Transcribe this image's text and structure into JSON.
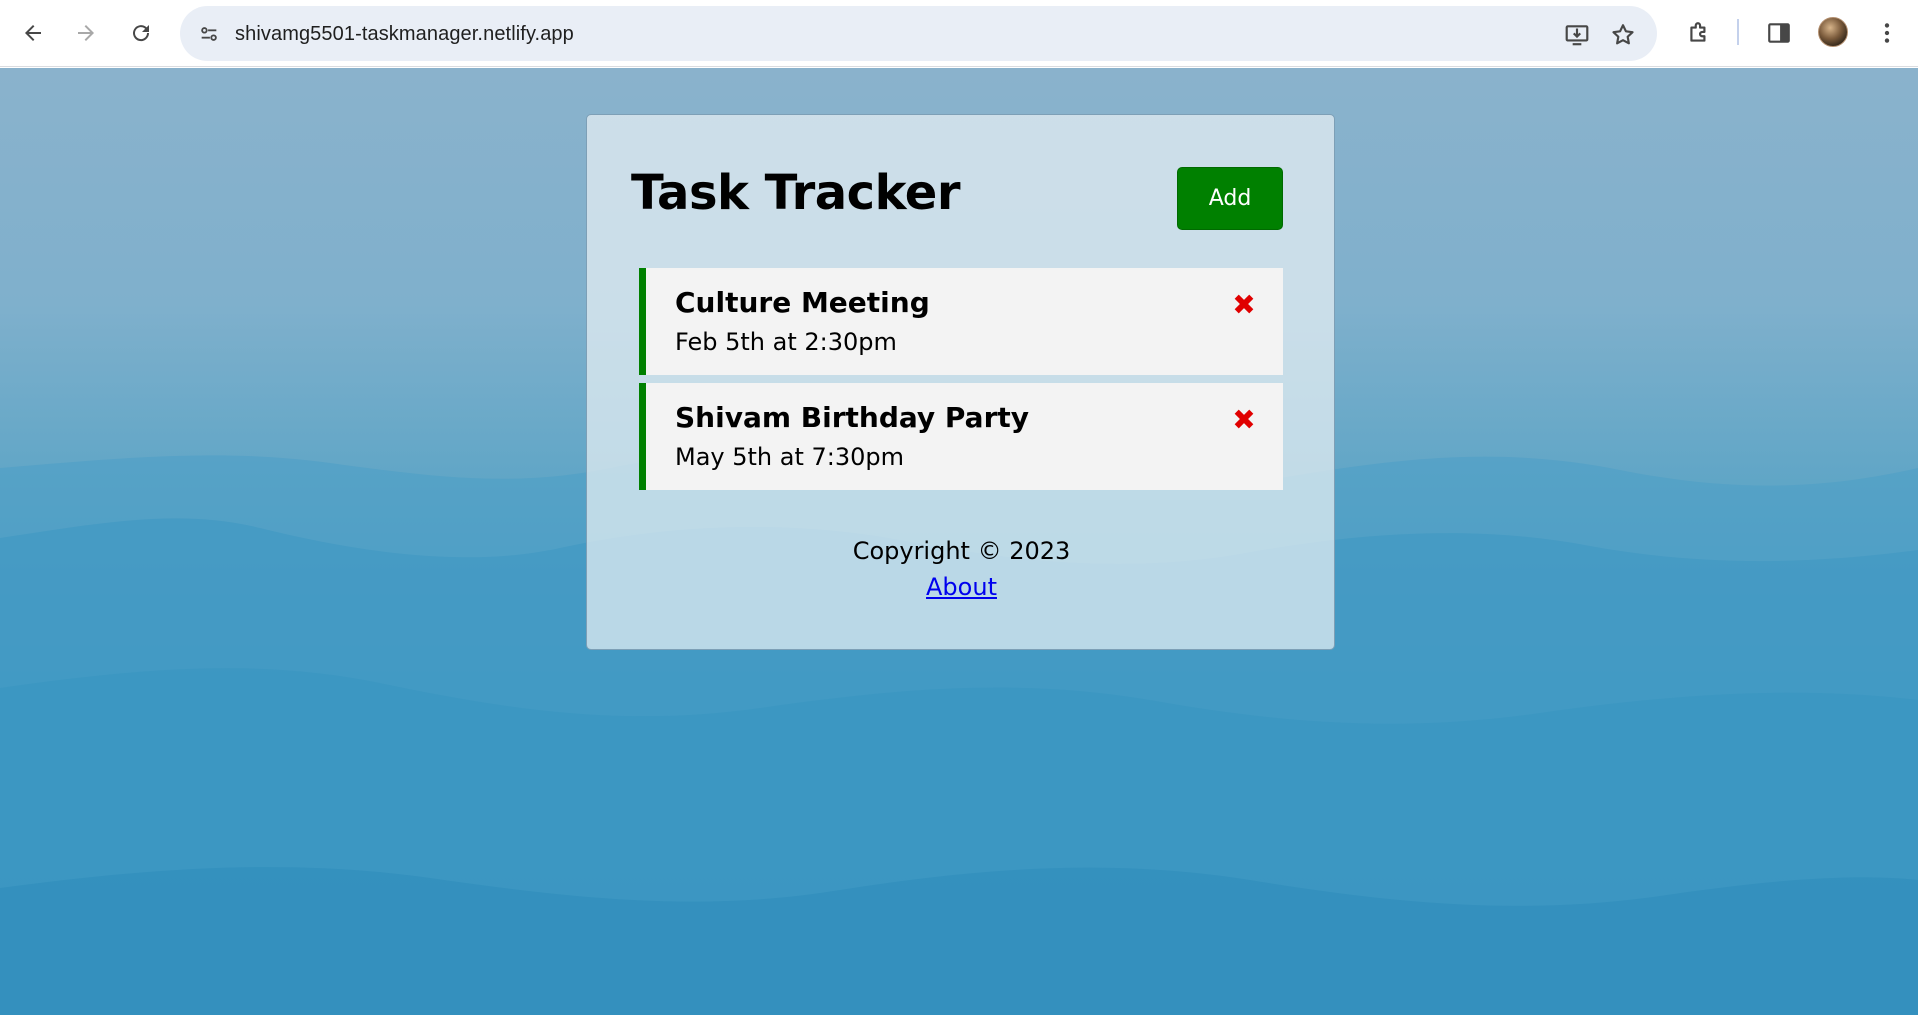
{
  "browser": {
    "url": "shivamg5501-taskmanager.netlify.app",
    "icons": [
      "back-arrow-icon",
      "forward-arrow-icon",
      "reload-icon",
      "site-info-icon",
      "install-app-icon",
      "bookmark-star-icon",
      "extensions-icon",
      "side-panel-icon",
      "profile-avatar",
      "more-menu-icon"
    ]
  },
  "app": {
    "title": "Task Tracker",
    "add_label": "Add",
    "tasks": [
      {
        "text": "Culture Meeting",
        "day": "Feb 5th at 2:30pm",
        "reminder": true
      },
      {
        "text": "Shivam Birthday Party",
        "day": "May 5th at 7:30pm",
        "reminder": true
      }
    ],
    "footer": {
      "copyright": "Copyright © 2023",
      "about_label": "About"
    }
  },
  "colors": {
    "accent": "#008000",
    "delete": "#e00000",
    "link": "#0000ee"
  }
}
